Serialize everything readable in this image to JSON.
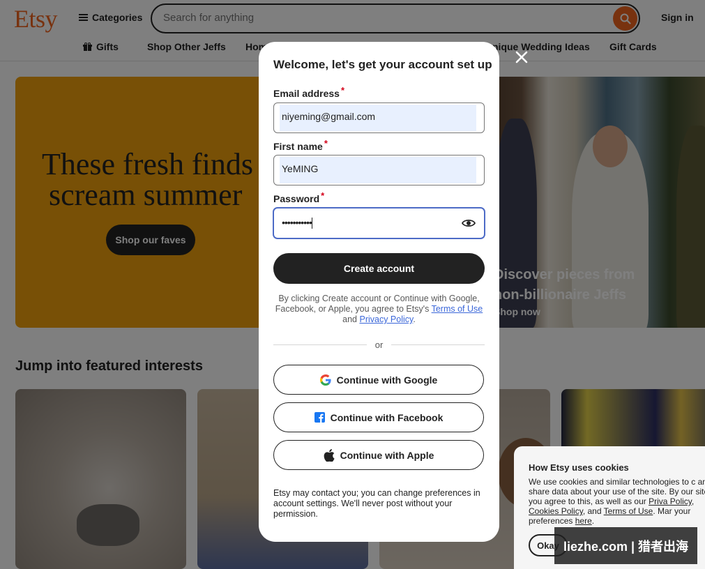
{
  "header": {
    "logo": "Etsy",
    "categories_label": "Categories",
    "search_placeholder": "Search for anything",
    "signin_label": "Sign in"
  },
  "nav": {
    "gifts": "Gifts",
    "shop_other_jeffs": "Shop Other Jeffs",
    "home_partial": "Hom",
    "wedding_partial": "nique Wedding Ideas",
    "gift_cards": "Gift Cards"
  },
  "hero": {
    "title_line1": "These fresh finds",
    "title_line2": "scream summer",
    "cta": "Shop our faves",
    "right_line1": "Discover pieces from",
    "right_line2": "non-billionaire Jeffs",
    "right_link": "Shop now"
  },
  "featured": {
    "title": "Jump into featured interests"
  },
  "modal": {
    "title": "Welcome, let's get your account set up",
    "email_label": "Email address",
    "email_value": "niyeming@gmail.com",
    "firstname_label": "First name",
    "firstname_value": "YeMING",
    "password_label": "Password",
    "password_value": "•••••••••••",
    "required_mark": "*",
    "create_button": "Create account",
    "terms_prefix": "By clicking Create account or Continue with Google, Facebook, or Apple, you agree to Etsy's",
    "terms_link": "Terms of Use",
    "terms_and": "and",
    "privacy_link": "Privacy Policy",
    "terms_end": ".",
    "or_label": "or",
    "google_button": "Continue with Google",
    "facebook_button": "Continue with Facebook",
    "apple_button": "Continue with Apple",
    "contact_note": "Etsy may contact you; you can change preferences in account settings. We'll never post without your permission."
  },
  "cookie": {
    "title": "How Etsy uses cookies",
    "text1": "We use cookies and similar technologies to c and share data about your use of the site. By our site, you agree to this, as well as our",
    "privacy_link": "Priva Policy",
    "comma": ",",
    "cookies_link": "Cookies Policy",
    "and": ", and",
    "terms_link": "Terms of Use",
    "text2": ". Mar your preferences",
    "here_link": "here",
    "okay_button": "Okay"
  },
  "watermark": "liezhe.com | 猎者出海",
  "colors": {
    "brand_orange": "#f1641e",
    "hero_yellow": "#f1a10c",
    "dark_button": "#222222",
    "link_blue": "#3b67d9",
    "autofill_blue": "#e8f0fe",
    "required_red": "#d4001a"
  },
  "icons": {
    "search": "search-icon",
    "close": "close-icon",
    "eye": "eye-icon",
    "google": "google-icon",
    "facebook": "facebook-icon",
    "apple": "apple-icon",
    "gift": "gift-icon",
    "menu": "hamburger-icon"
  }
}
